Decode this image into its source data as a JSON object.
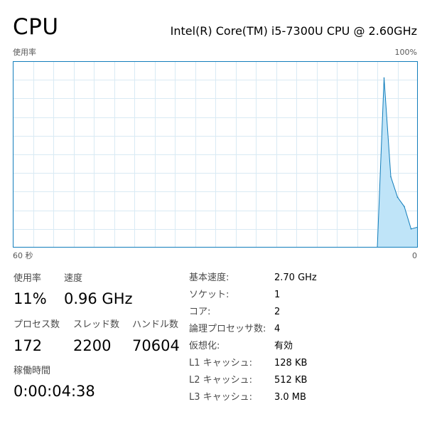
{
  "header": {
    "title": "CPU",
    "model": "Intel(R) Core(TM) i5-7300U CPU @ 2.60GHz"
  },
  "graph": {
    "y_label": "使用率",
    "y_max_label": "100%",
    "x_left_label": "60 秒",
    "x_right_label": "0",
    "line_color": "#117dbb",
    "fill_color": "#bfe4f8",
    "grid_color": "#d9eaf4",
    "border_color": "#117dbb"
  },
  "chart_data": {
    "type": "area",
    "x": [
      0,
      1,
      2,
      3,
      4,
      5,
      6,
      7,
      8,
      9,
      10,
      11,
      12,
      13,
      14,
      15,
      16,
      17,
      18,
      19,
      20,
      21,
      22,
      23,
      24,
      25,
      26,
      27,
      28,
      29,
      30,
      31,
      32,
      33,
      34,
      35,
      36,
      37,
      38,
      39,
      40,
      41,
      42,
      43,
      44,
      45,
      46,
      47,
      48,
      49,
      50,
      51,
      52,
      53,
      54,
      55,
      56,
      57,
      58,
      59,
      60
    ],
    "series": [
      {
        "values": [
          null,
          null,
          null,
          null,
          null,
          null,
          null,
          null,
          null,
          null,
          null,
          null,
          null,
          null,
          null,
          null,
          null,
          null,
          null,
          null,
          null,
          null,
          null,
          null,
          null,
          null,
          null,
          null,
          null,
          null,
          null,
          null,
          null,
          null,
          null,
          null,
          null,
          null,
          null,
          null,
          null,
          null,
          null,
          null,
          null,
          null,
          null,
          null,
          null,
          null,
          null,
          null,
          null,
          null,
          0,
          91,
          38,
          27,
          22,
          10,
          11
        ]
      }
    ],
    "xlim": [
      0,
      60
    ],
    "ylim": [
      0,
      100
    ],
    "grid": true
  },
  "stats": {
    "utilization": {
      "label": "使用率",
      "value": "11%"
    },
    "speed": {
      "label": "速度",
      "value": "0.96 GHz"
    },
    "processes": {
      "label": "プロセス数",
      "value": "172"
    },
    "threads": {
      "label": "スレッド数",
      "value": "2200"
    },
    "handles": {
      "label": "ハンドル数",
      "value": "70604"
    },
    "uptime": {
      "label": "稼働時間",
      "value": "0:00:04:38"
    }
  },
  "specs": [
    {
      "key": "基本速度:",
      "value": "2.70 GHz"
    },
    {
      "key": "ソケット:",
      "value": "1"
    },
    {
      "key": "コア:",
      "value": "2"
    },
    {
      "key": "論理プロセッサ数:",
      "value": "4"
    },
    {
      "key": "仮想化:",
      "value": "有効"
    },
    {
      "key": "L1 キャッシュ:",
      "value": "128 KB"
    },
    {
      "key": "L2 キャッシュ:",
      "value": "512 KB"
    },
    {
      "key": "L3 キャッシュ:",
      "value": "3.0 MB"
    }
  ]
}
